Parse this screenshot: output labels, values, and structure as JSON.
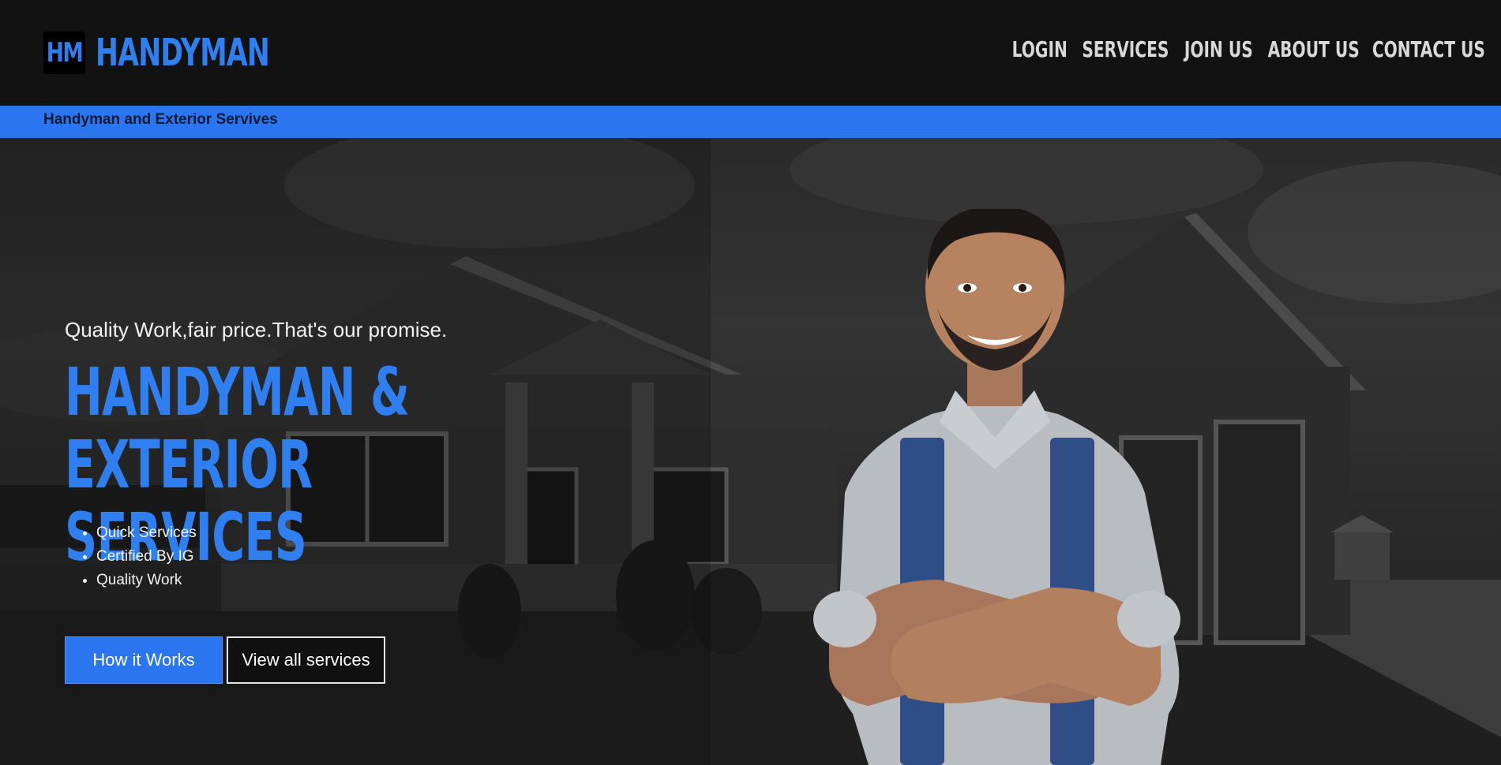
{
  "brand": {
    "badge": "HM",
    "name": "HANDYMAN",
    "accent_color": "#2f7ff0"
  },
  "nav": {
    "login": "LOGIN",
    "services": "SERVICES",
    "join": "JOIN US",
    "about": "ABOUT US",
    "contact": "CONTACT US"
  },
  "subbar": {
    "text": "Handyman and Exterior Servives",
    "color": "#2b76f0"
  },
  "hero": {
    "tagline": "Quality Work,fair price.That's our promise.",
    "headline_line1": "HANDYMAN & EXTERIOR",
    "headline_line2": "SERVICES",
    "features": [
      "Quick Services",
      "Certified By IG",
      "Quality Work"
    ],
    "primary_button": "How it Works",
    "secondary_button": "View all services",
    "background": "house-photo-grayscale",
    "figure": "handyman-portrait"
  }
}
